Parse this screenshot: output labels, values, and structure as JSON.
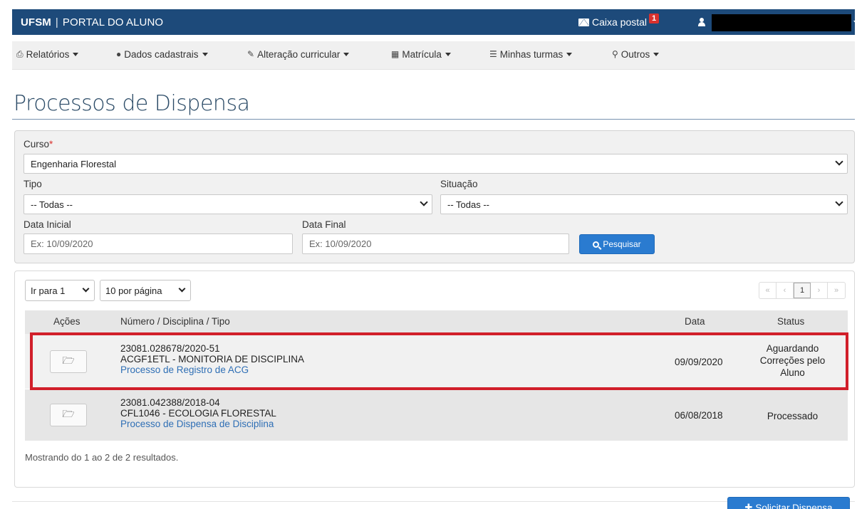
{
  "header": {
    "brand_strong": "UFSM",
    "brand_sep": "|",
    "brand_rest": "PORTAL DO ALUNO",
    "mailbox_label": "Caixa postal",
    "mailbox_count": "1"
  },
  "nav": {
    "items": [
      {
        "label": "Relatórios",
        "icon": "print-icon"
      },
      {
        "label": "Dados cadastrais",
        "icon": "user-icon"
      },
      {
        "label": "Alteração curricular",
        "icon": "edit-icon"
      },
      {
        "label": "Matrícula",
        "icon": "table-icon"
      },
      {
        "label": "Minhas turmas",
        "icon": "list-icon"
      },
      {
        "label": "Outros",
        "icon": "sitemap-icon"
      }
    ]
  },
  "page": {
    "title": "Processos de Dispensa"
  },
  "filters": {
    "curso_label": "Curso",
    "curso_required": "*",
    "curso_value": "Engenharia Florestal",
    "tipo_label": "Tipo",
    "tipo_value": "-- Todas --",
    "situacao_label": "Situação",
    "situacao_value": "-- Todas --",
    "data_inicial_label": "Data Inicial",
    "data_inicial_placeholder": "Ex: 10/09/2020",
    "data_final_label": "Data Final",
    "data_final_placeholder": "Ex: 10/09/2020",
    "search_label": "Pesquisar"
  },
  "results": {
    "goto_label": "Ir para 1",
    "per_page_label": "10 por página",
    "pager": {
      "first": "«",
      "prev": "‹",
      "current": "1",
      "next": "›",
      "last": "»"
    },
    "columns": {
      "acoes": "Ações",
      "numero": "Número / Disciplina / Tipo",
      "data": "Data",
      "status": "Status"
    },
    "rows": [
      {
        "numero": "23081.028678/2020-51",
        "disciplina": "ACGF1ETL - MONITORIA DE DISCIPLINA",
        "tipo": "Processo de Registro de ACG",
        "data": "09/09/2020",
        "status_lines": [
          "Aguardando",
          "Correções pelo",
          "Aluno"
        ]
      },
      {
        "numero": "23081.042388/2018-04",
        "disciplina": "CFL1046 - ECOLOGIA FLORESTAL",
        "tipo": "Processo de Dispensa de Disciplina",
        "data": "06/08/2018",
        "status_lines": [
          "Processado"
        ]
      }
    ],
    "info": "Mostrando do 1 ao 2 de 2 resultados."
  },
  "actions": {
    "solicitar_label": "Solicitar Dispensa"
  },
  "colors": {
    "topbar": "#1d4a7a",
    "primary": "#2a7bd0",
    "highlight": "#d11f2a",
    "link": "#2f6fb5"
  }
}
